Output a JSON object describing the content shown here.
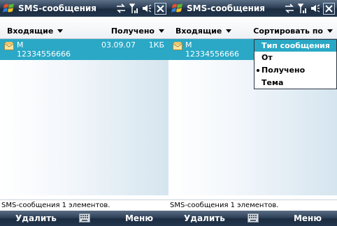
{
  "screens": [
    {
      "title": "SMS-сообщения",
      "header": {
        "left_label": "Входящие",
        "right_label": "Получено"
      },
      "message": {
        "from": "M",
        "number": "12334556666",
        "date": "03.09.07",
        "size": "1КБ"
      },
      "status": "SMS-сообщения  1 элементов.",
      "softkeys": {
        "left": "Удалить",
        "right": "Меню"
      }
    },
    {
      "title": "SMS-сообщения",
      "header": {
        "left_label": "Входящие",
        "right_label": "Сортировать по"
      },
      "message": {
        "from": "M",
        "number": "12334556666"
      },
      "dropdown": {
        "items": [
          {
            "label": "Тип сообщения",
            "highlighted": true,
            "checked": false
          },
          {
            "label": "От",
            "highlighted": false,
            "checked": false
          },
          {
            "label": "Получено",
            "highlighted": false,
            "checked": true
          },
          {
            "label": "Тема",
            "highlighted": false,
            "checked": false
          }
        ]
      },
      "status": "SMS-сообщения  1 элементов.",
      "softkeys": {
        "left": "Удалить",
        "right": "Меню"
      }
    }
  ],
  "icons": {
    "start": "windows-flag-icon",
    "connectivity": "connection-arrows-icon",
    "signal": "signal-strength-icon",
    "volume": "speaker-volume-icon",
    "close": "close-icon",
    "message": "sms-envelope-icon",
    "keyboard": "keyboard-icon"
  },
  "colors": {
    "title_bar": "#23374e",
    "highlight": "#2aa8c6",
    "list_gradient_end": "#d5e5ef"
  }
}
